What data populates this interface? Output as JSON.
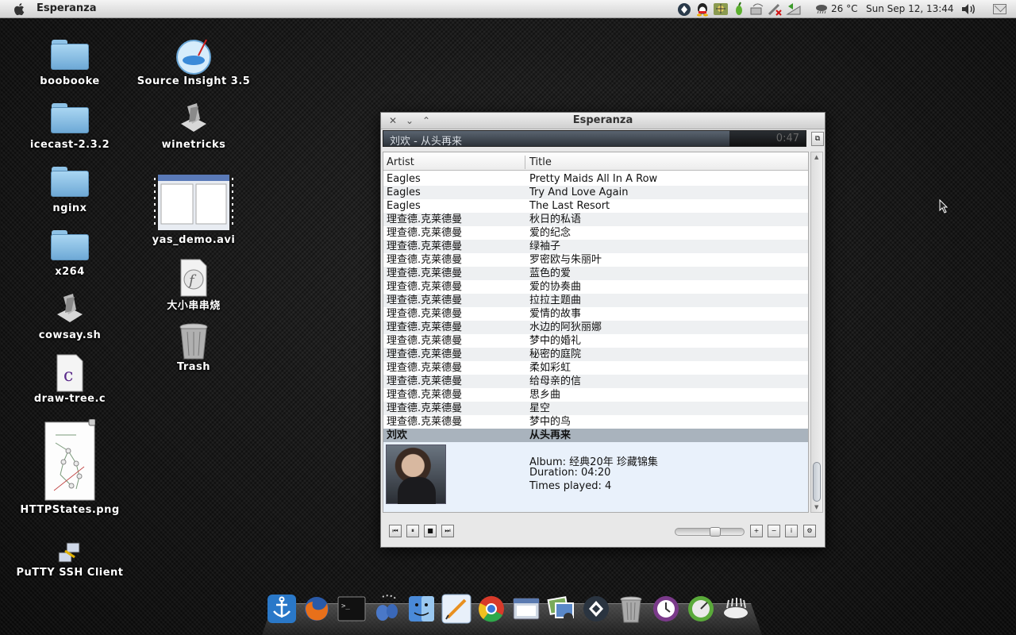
{
  "topbar": {
    "app_name": "Esperanza",
    "weather": "26 °C",
    "clock": "Sun Sep 12, 13:44"
  },
  "desktop": {
    "icons": [
      {
        "label": "boobooke",
        "icon": "folder-icon"
      },
      {
        "label": "icecast-2.3.2",
        "icon": "folder-icon"
      },
      {
        "label": "nginx",
        "icon": "folder-icon"
      },
      {
        "label": "x264",
        "icon": "folder-icon"
      },
      {
        "label": "cowsay.sh",
        "icon": "script-icon"
      },
      {
        "label": "draw-tree.c",
        "icon": "c-source-icon"
      },
      {
        "label": "HTTPStates.png",
        "icon": "image-icon"
      },
      {
        "label": "PuTTY SSH Client",
        "icon": "putty-icon"
      },
      {
        "label": "Source Insight 3.5",
        "icon": "source-insight-icon"
      },
      {
        "label": "winetricks",
        "icon": "script-icon"
      },
      {
        "label": "yas_demo.avi",
        "icon": "video-icon"
      },
      {
        "label": "大小串串烧",
        "icon": "flash-icon"
      },
      {
        "label": "Trash",
        "icon": "trash-icon"
      }
    ]
  },
  "player": {
    "title": "Esperanza",
    "now_playing": "刘欢 - 从头再来",
    "elapsed": "0:47",
    "columns": {
      "artist": "Artist",
      "title": "Title"
    },
    "tracks": [
      {
        "artist": "Eagles",
        "title": "Pretty Maids All In A Row"
      },
      {
        "artist": "Eagles",
        "title": "Try And Love Again"
      },
      {
        "artist": "Eagles",
        "title": "The Last Resort"
      },
      {
        "artist": "理查德.克莱德曼",
        "title": "秋日的私语"
      },
      {
        "artist": "理查德.克莱德曼",
        "title": "爱的纪念"
      },
      {
        "artist": "理查德.克莱德曼",
        "title": "绿袖子"
      },
      {
        "artist": "理查德.克莱德曼",
        "title": "罗密欧与朱丽叶"
      },
      {
        "artist": "理查德.克莱德曼",
        "title": "蓝色的爱"
      },
      {
        "artist": "理查德.克莱德曼",
        "title": "爱的协奏曲"
      },
      {
        "artist": "理查德.克莱德曼",
        "title": "拉拉主题曲"
      },
      {
        "artist": "理查德.克莱德曼",
        "title": "爱情的故事"
      },
      {
        "artist": "理查德.克莱德曼",
        "title": "水边的阿狄丽娜"
      },
      {
        "artist": "理查德.克莱德曼",
        "title": "梦中的婚礼"
      },
      {
        "artist": "理查德.克莱德曼",
        "title": "秘密的庭院"
      },
      {
        "artist": "理查德.克莱德曼",
        "title": "柔如彩虹"
      },
      {
        "artist": "理查德.克莱德曼",
        "title": "给母亲的信"
      },
      {
        "artist": "理查德.克莱德曼",
        "title": "思乡曲"
      },
      {
        "artist": "理查德.克莱德曼",
        "title": "星空"
      },
      {
        "artist": "理查德.克莱德曼",
        "title": "梦中的鸟"
      },
      {
        "artist": "刘欢",
        "title": "从头再来",
        "current": true
      }
    ],
    "detail": {
      "album": "Album: 经典20年 珍藏锦集",
      "duration": "Duration: 04:20",
      "times_played": "Times played: 4"
    },
    "volume_level": 0.6
  },
  "dock": {
    "items": [
      "anchor-icon",
      "firefox-icon",
      "terminal-icon",
      "pidgin-icon",
      "finder-icon",
      "editor-icon",
      "chrome-icon",
      "window-manager-icon",
      "iphoto-icon",
      "vmware-icon",
      "trash-icon",
      "time-machine-icon",
      "dashboard-icon",
      "cloud-icon"
    ]
  },
  "colors": {
    "playlist_current_row": "#a9b3bd",
    "detail_background": "#e9f1fb"
  }
}
